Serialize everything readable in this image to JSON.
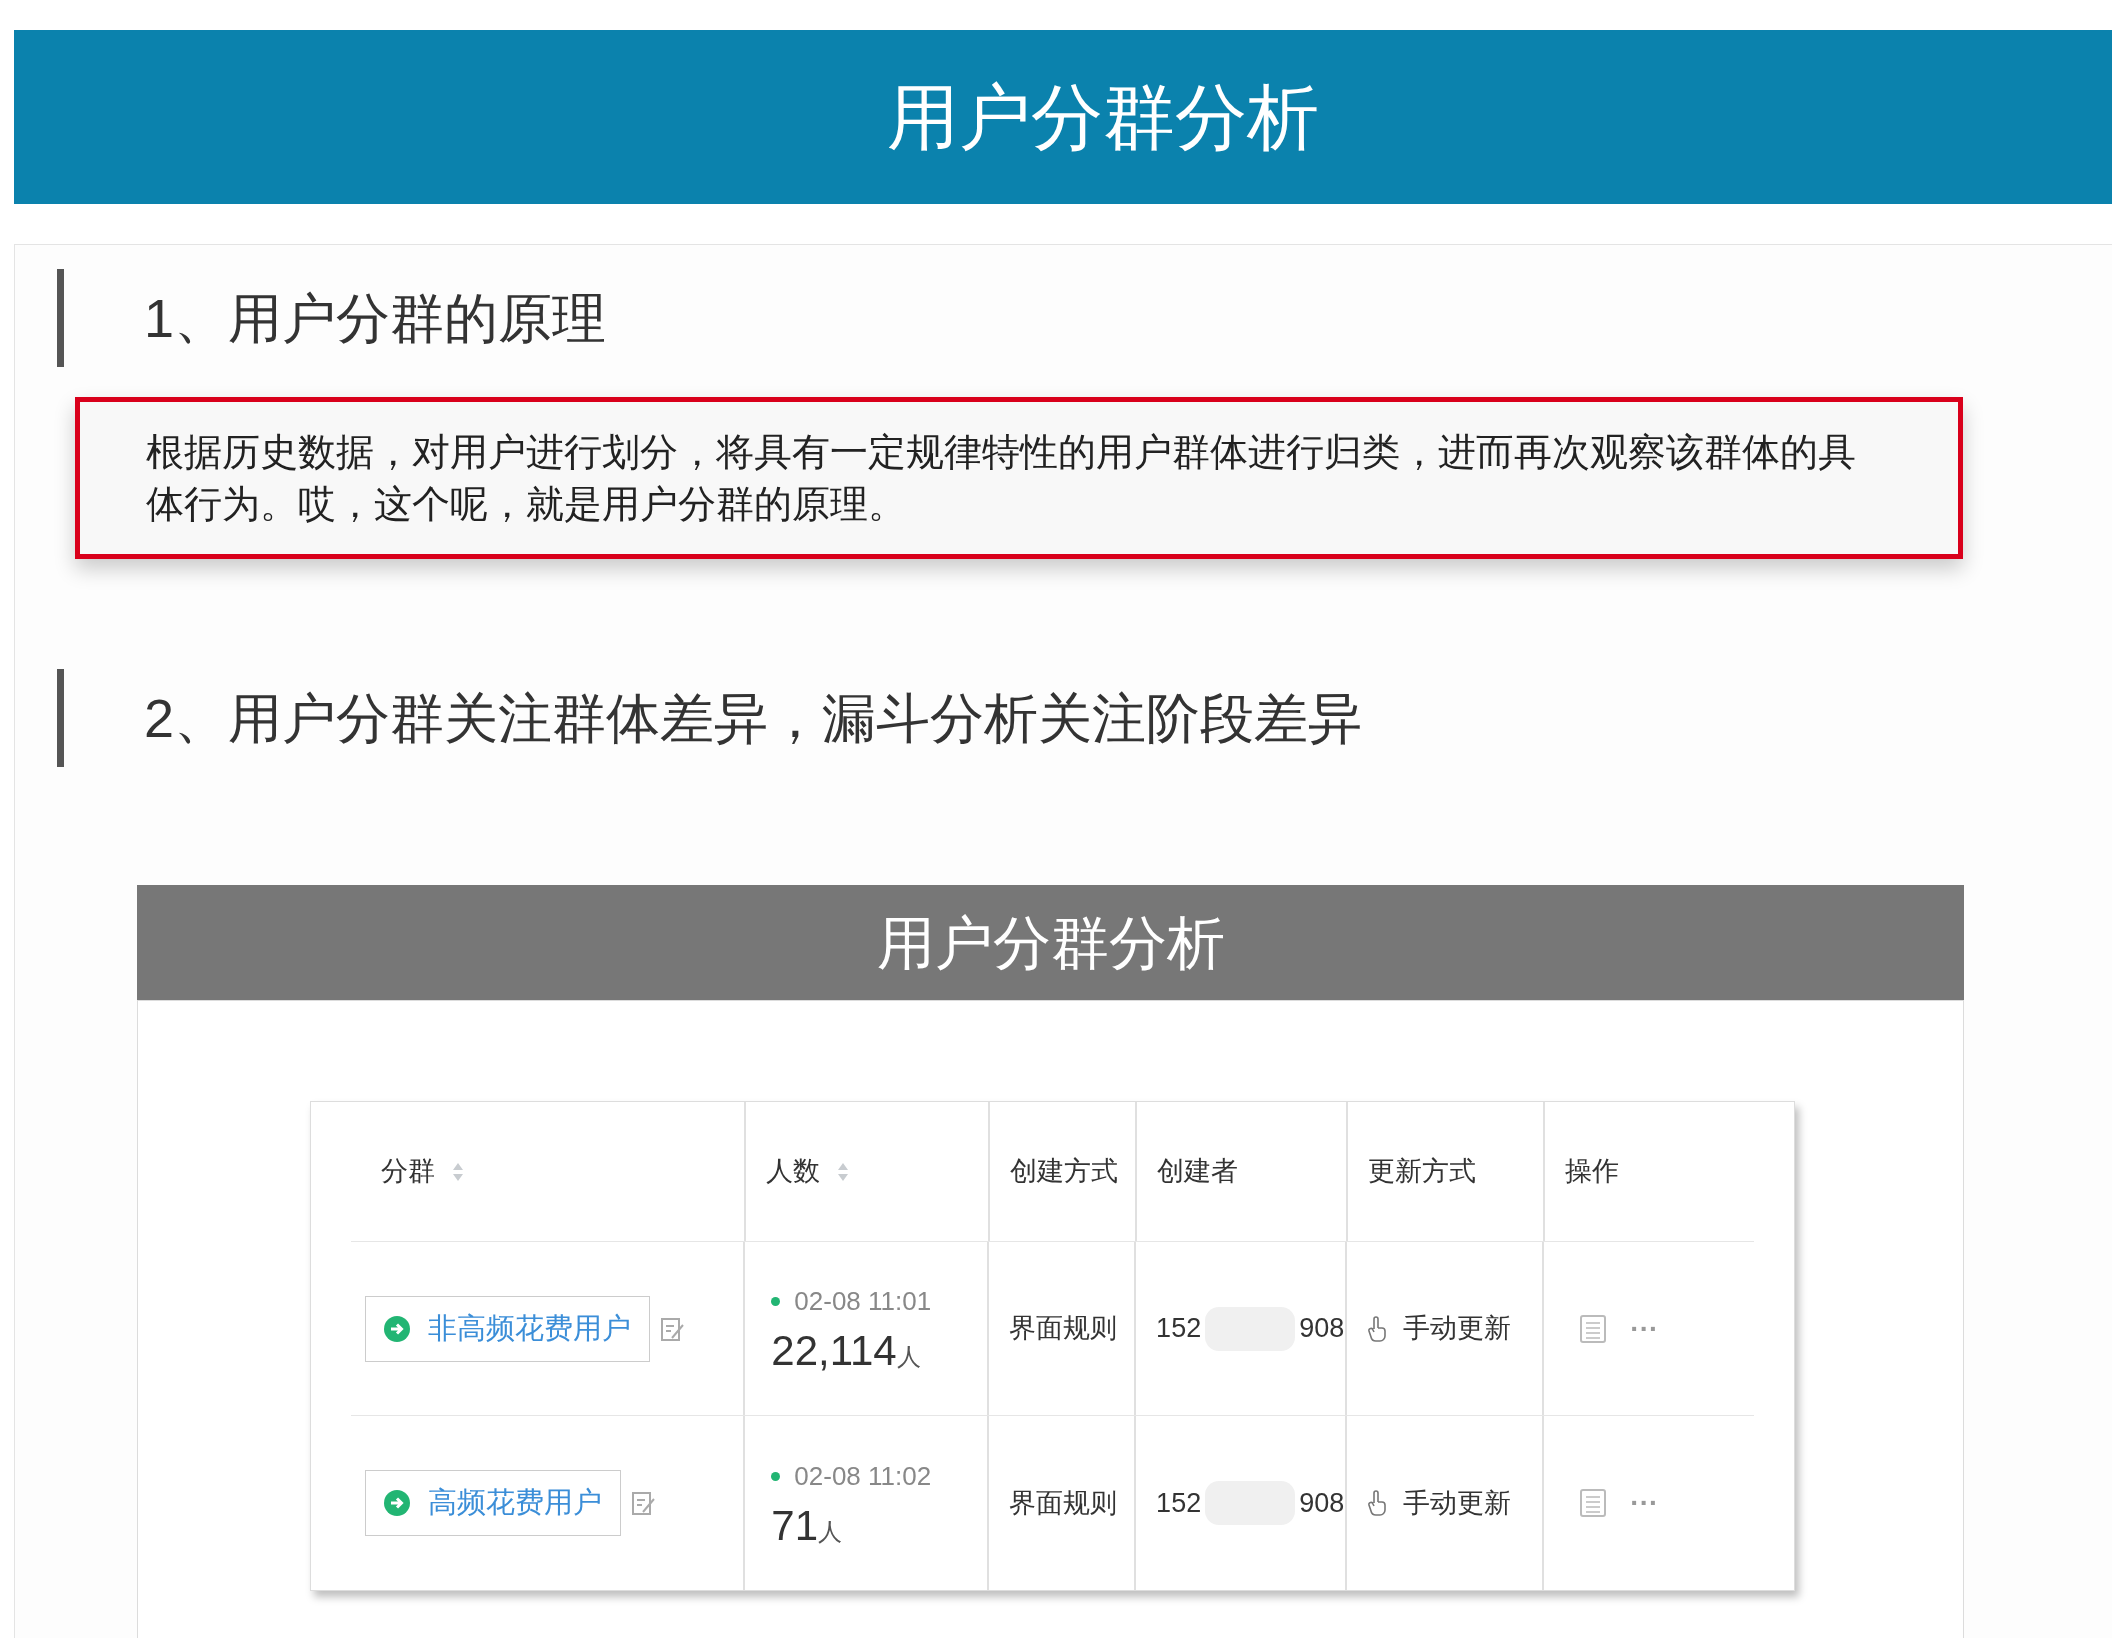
{
  "banner": {
    "title": "用户分群分析"
  },
  "sections": [
    {
      "heading": "1、用户分群的原理",
      "highlight": "根据历史数据，对用户进行划分，将具有一定规律特性的用户群体进行归类，进而再次观察该群体的具体行为。哎，这个呢，就是用户分群的原理。"
    },
    {
      "heading": "2、用户分群关注群体差异，漏斗分析关注阶段差异"
    }
  ],
  "figure": {
    "title": "用户分群分析",
    "table": {
      "columns": [
        {
          "label": "分群",
          "sortable": true
        },
        {
          "label": "人数",
          "sortable": true
        },
        {
          "label": "创建方式",
          "sortable": false
        },
        {
          "label": "创建者",
          "sortable": false
        },
        {
          "label": "更新方式",
          "sortable": false
        },
        {
          "label": "操作",
          "sortable": false
        }
      ],
      "rows": [
        {
          "segment": "非高频花费用户",
          "time": "02-08 11:01",
          "count": "22,114",
          "unit": "人",
          "method": "界面规则",
          "creator_start": "152",
          "creator_end": "908",
          "update": "手动更新",
          "more": "···"
        },
        {
          "segment": "高频花费用户",
          "time": "02-08 11:02",
          "count": "71",
          "unit": "人",
          "method": "界面规则",
          "creator_start": "152",
          "creator_end": "908",
          "update": "手动更新",
          "more": "···"
        }
      ]
    }
  }
}
